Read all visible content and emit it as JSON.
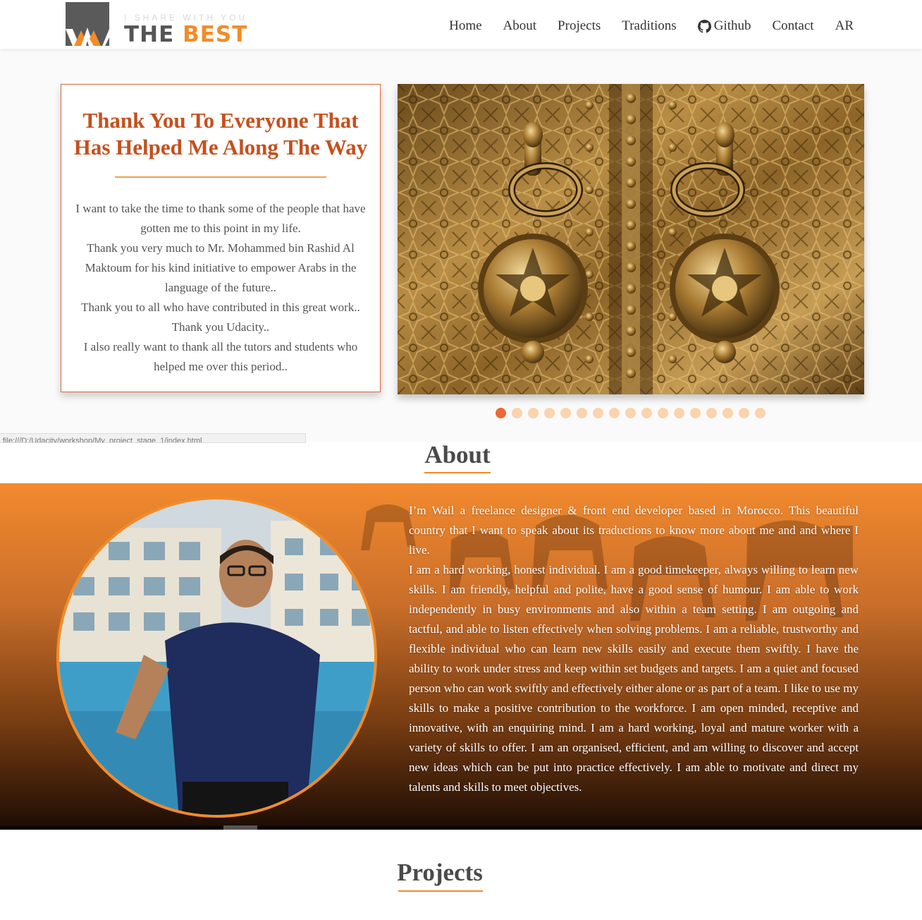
{
  "brand": {
    "tagline": "I SHARE WITH YOU",
    "name_part1": "THE ",
    "name_part2": "BEST",
    "logo_icon": "w-logo-icon"
  },
  "nav": {
    "items": [
      {
        "label": "Home"
      },
      {
        "label": "About"
      },
      {
        "label": "Projects"
      },
      {
        "label": "Traditions"
      },
      {
        "label": "Github",
        "icon": "github-icon"
      },
      {
        "label": "Contact"
      },
      {
        "label": "AR"
      }
    ]
  },
  "hero": {
    "title": "Thank You To Everyone That Has Helped Me Along The Way",
    "lines": [
      "I want to take the time to thank some of the people that have gotten me to this point in my life.",
      "Thank you very much to Mr. Mohammed bin Rashid Al Maktoum for his kind initiative to empower Arabs in the language of the future..",
      "Thank you to all who have contributed in this great work..",
      "Thank you Udacity..",
      "I also really want to thank all the tutors and students who helped me over this period.."
    ],
    "slider_image": "ornate-brass-door-knockers",
    "slide_count": 17,
    "active_slide": 1
  },
  "status_bar": {
    "url": "file:///D:/Udacity/workshop/My_project_stage_1/index.html"
  },
  "about": {
    "title": "About",
    "photo": "profile-photo",
    "paragraphs": [
      "I’m Wail a freelance designer & front end developer based in Morocco. This beautiful country that I want to speak about its traductions to know more about me and and where I live.",
      "I am a hard working, honest individual. I am a good timekeeper, always willing to learn new skills. I am friendly, helpful and polite, have a good sense of humour. I am able to work independently in busy environments and also within a team setting. I am outgoing and tactful, and able to listen effectively when solving problems. I am a reliable, trustworthy and flexible individual who can learn new skills easily and execute them swiftly. I have the ability to work under stress and keep within set budgets and targets. I am a quiet and focused person who can work swiftly and effectively either alone or as part of a team. I like to use my skills to make a positive contribution to the workforce. I am open minded, receptive and innovative, with an enquiring mind. I am a hard working, loyal and mature worker with a variety of skills to offer. I am an organised, efficient, and am willing to discover and accept new ideas which can be put into practice effectively. I am able to motivate and direct my talents and skills to meet objectives."
    ]
  },
  "projects": {
    "title": "Projects"
  },
  "colors": {
    "accent": "#f28c28",
    "title_red": "#c4501e",
    "dot_active": "#ec6a35",
    "dot_inactive": "#fbd3ad"
  }
}
